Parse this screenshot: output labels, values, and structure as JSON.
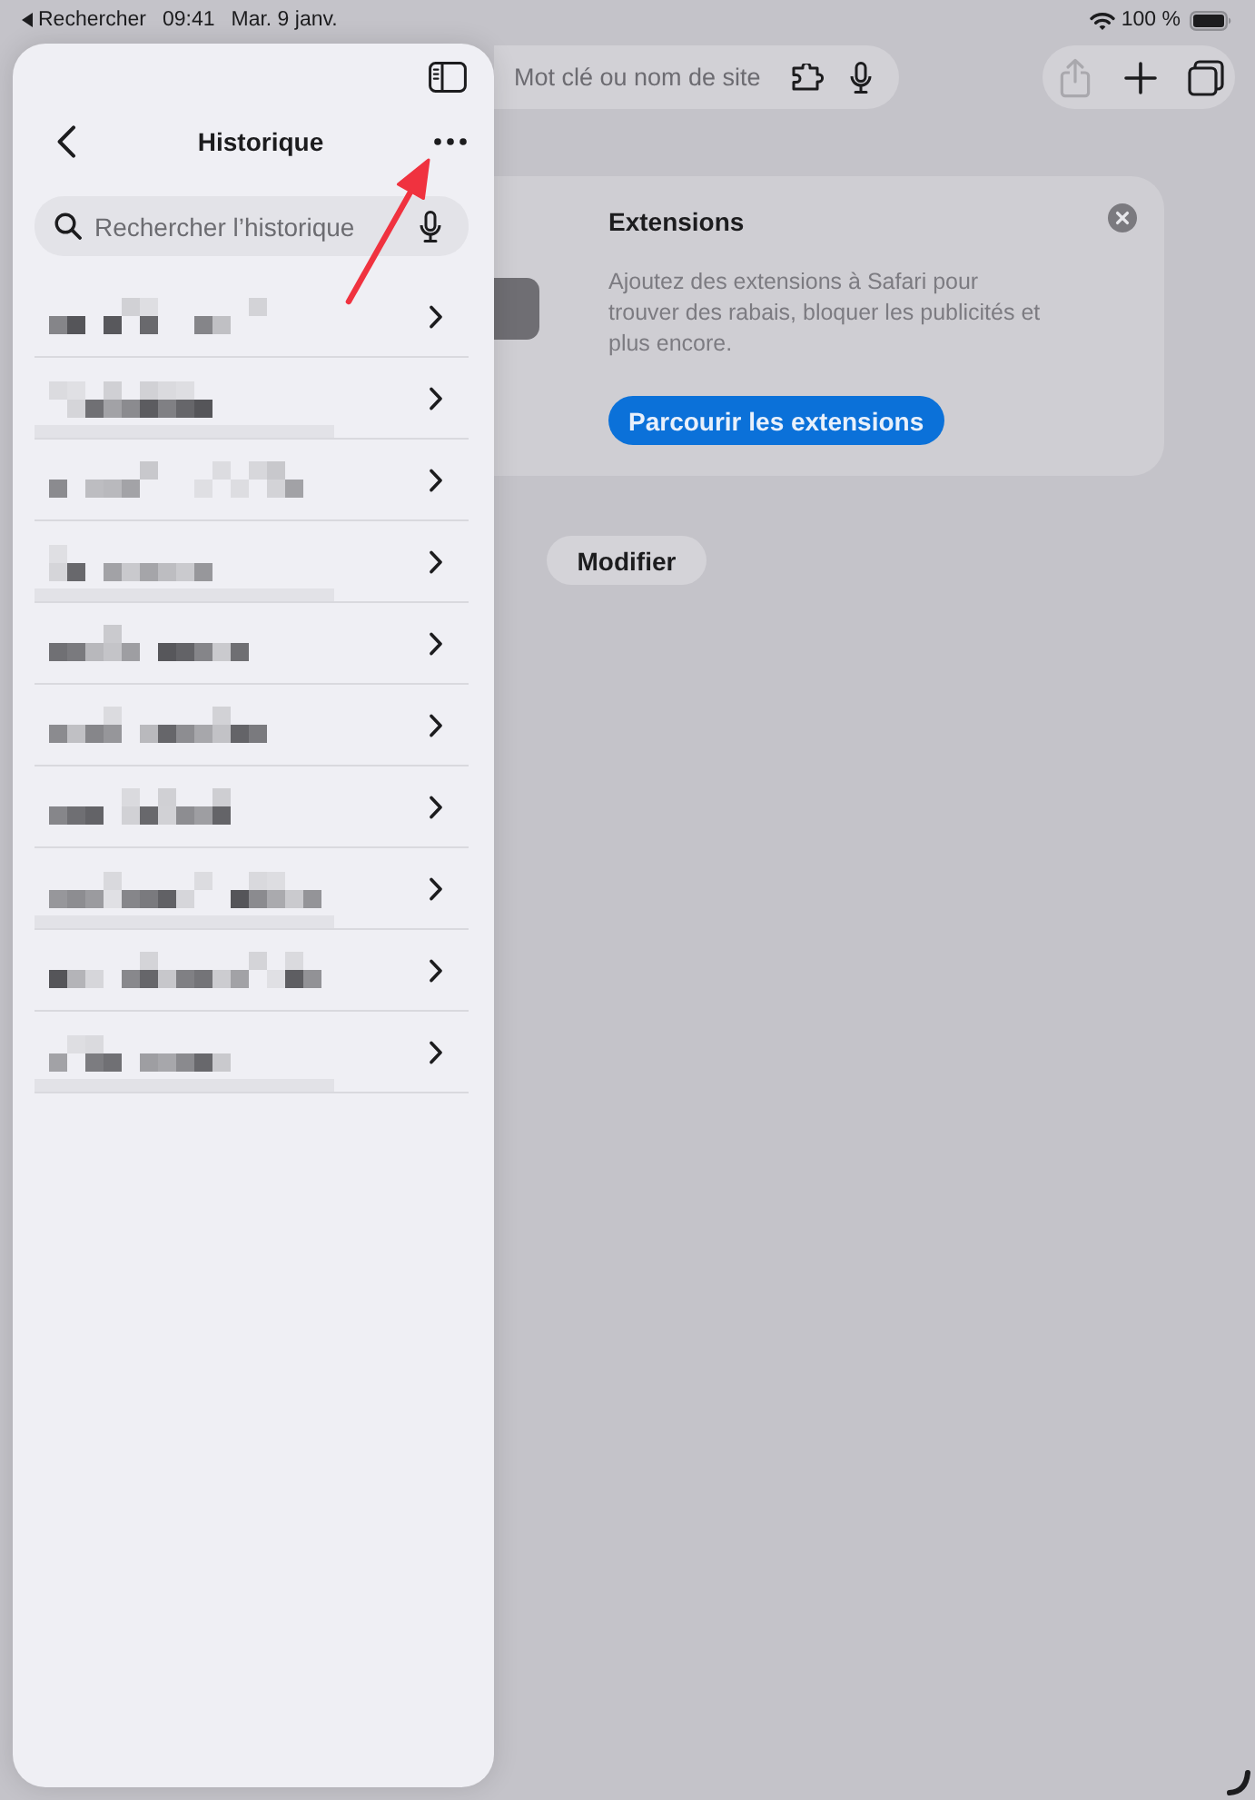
{
  "status_bar": {
    "back_label": "Rechercher",
    "time": "09:41",
    "date": "Mar. 9 janv.",
    "battery": "100 %"
  },
  "toolbar": {
    "address_bar": {
      "placeholder": "Mot clé ou nom de site"
    },
    "share_button": {
      "disabled": true
    }
  },
  "sidebar": {
    "title": "Historique",
    "search": {
      "placeholder": "Rechercher l’historique"
    },
    "rows": [
      {
        "kind": "title"
      },
      {
        "kind": "title-url"
      },
      {
        "kind": "title"
      },
      {
        "kind": "title-url"
      },
      {
        "kind": "title"
      },
      {
        "kind": "title"
      },
      {
        "kind": "title"
      },
      {
        "kind": "title-url"
      },
      {
        "kind": "title"
      },
      {
        "kind": "title-url"
      }
    ]
  },
  "extensions_card": {
    "title": "Extensions",
    "description": "Ajoutez des extensions à Safari pour trouver des rabais, bloquer les publicités et plus encore.",
    "button": "Parcourir les extensions"
  },
  "edit_button": "Modifier"
}
